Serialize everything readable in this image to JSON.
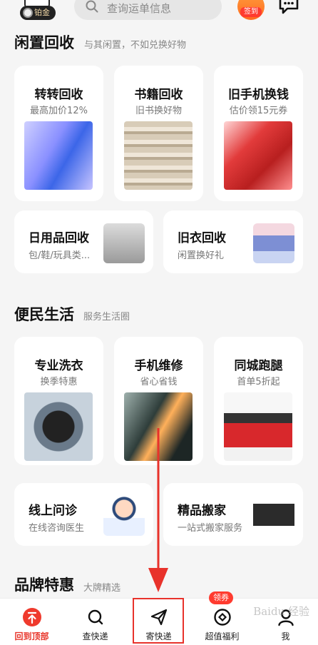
{
  "header": {
    "member_badge": "铂金",
    "search_placeholder": "查询运单信息",
    "signin_label": "签到"
  },
  "sections": {
    "recycle": {
      "title": "闲置回收",
      "subtitle": "与其闲置，不如兑换好物",
      "cards": [
        {
          "title": "转转回收",
          "subtitle": "最高加价12%"
        },
        {
          "title": "书籍回收",
          "subtitle": "旧书换好物"
        },
        {
          "title": "旧手机换钱",
          "subtitle": "估价领15元券"
        }
      ],
      "wide": [
        {
          "title": "日用品回收",
          "subtitle": "包/鞋/玩具类..."
        },
        {
          "title": "旧衣回收",
          "subtitle": "闲置换好礼"
        }
      ]
    },
    "life": {
      "title": "便民生活",
      "subtitle": "服务生活圈",
      "cards": [
        {
          "title": "专业洗衣",
          "subtitle": "换季特惠"
        },
        {
          "title": "手机维修",
          "subtitle": "省心省钱"
        },
        {
          "title": "同城跑腿",
          "subtitle": "首单5折起"
        }
      ],
      "wide": [
        {
          "title": "线上问诊",
          "subtitle": "在线咨询医生"
        },
        {
          "title": "精品搬家",
          "subtitle": "一站式搬家服务"
        }
      ]
    },
    "brand": {
      "title": "品牌特惠",
      "subtitle": "大牌精选"
    }
  },
  "tabbar": {
    "tabs": [
      {
        "label": "回到顶部",
        "active": true
      },
      {
        "label": "查快递",
        "active": false
      },
      {
        "label": "寄快递",
        "active": false
      },
      {
        "label": "超值福利",
        "active": false,
        "badge": "领券"
      },
      {
        "label": "我",
        "active": false
      }
    ]
  },
  "watermark": "Baidu 经验",
  "colors": {
    "accent": "#e8352a",
    "highlight": "#e8322b"
  }
}
